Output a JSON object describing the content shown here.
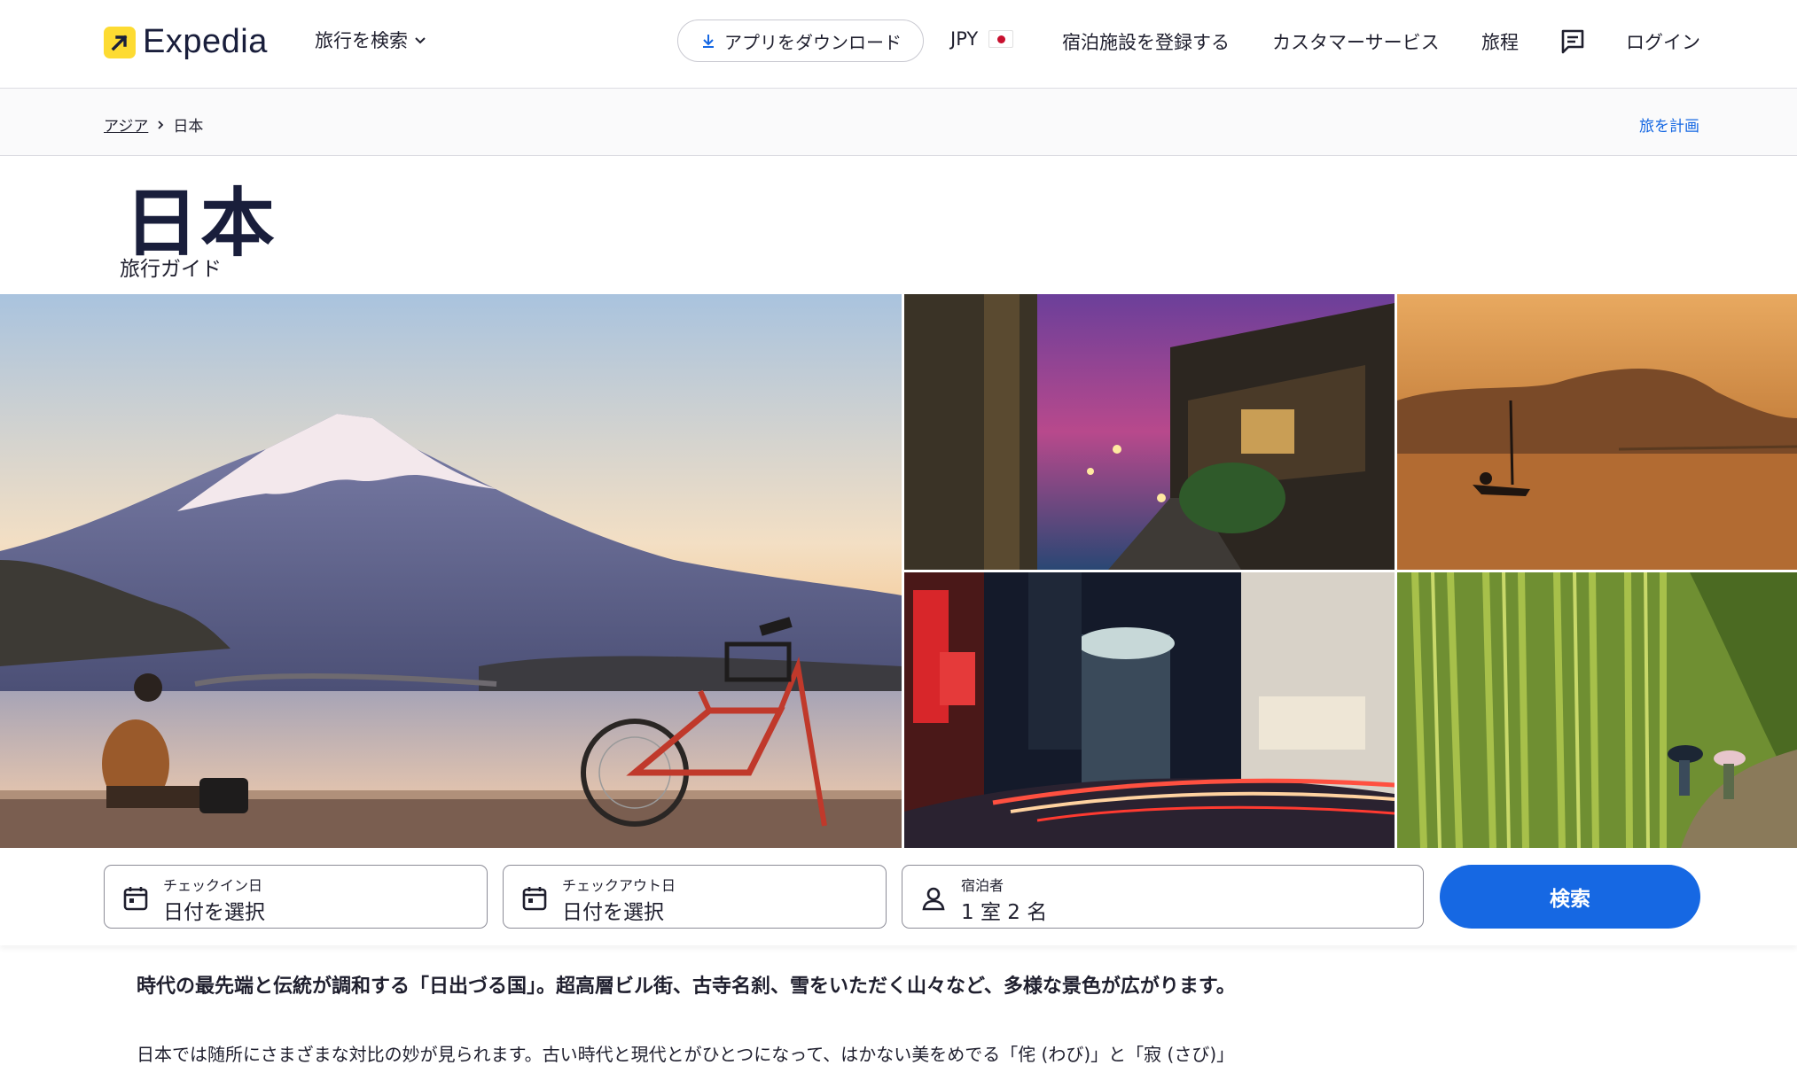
{
  "header": {
    "logo_text": "Expedia",
    "search_menu": "旅行を検索",
    "app_download": "アプリをダウンロード",
    "currency": "JPY",
    "list_property": "宿泊施設を登録する",
    "customer_service": "カスタマーサービス",
    "trips": "旅程",
    "login": "ログイン",
    "brand_color": "#fddb32"
  },
  "breadcrumb": {
    "items": [
      "アジア",
      "日本"
    ],
    "plan_trip": "旅を計画"
  },
  "page": {
    "title": "日本",
    "subtitle": "旅行ガイド"
  },
  "gallery": {
    "images": [
      "mount-fuji-bicycle",
      "night-alley-traditional-houses",
      "lake-boat-sunset",
      "city-night-light-trails",
      "bamboo-forest-path"
    ]
  },
  "search_form": {
    "checkin_label": "チェックイン日",
    "checkin_value": "日付を選択",
    "checkout_label": "チェックアウト日",
    "checkout_value": "日付を選択",
    "guests_label": "宿泊者",
    "guests_value": "1 室 2 名",
    "search_button": "検索",
    "accent_color": "#1668e3"
  },
  "description": {
    "lead": "時代の最先端と伝統が調和する「日出づる国」。超高層ビル街、古寺名刹、雪をいただく山々など、多様な景色が広がります。",
    "body": "日本では随所にさまざまな対比の妙が見られます。古い時代と現代とがひとつになって、はかない美をめでる「侘 (わび)」と「寂 (さび)」"
  }
}
